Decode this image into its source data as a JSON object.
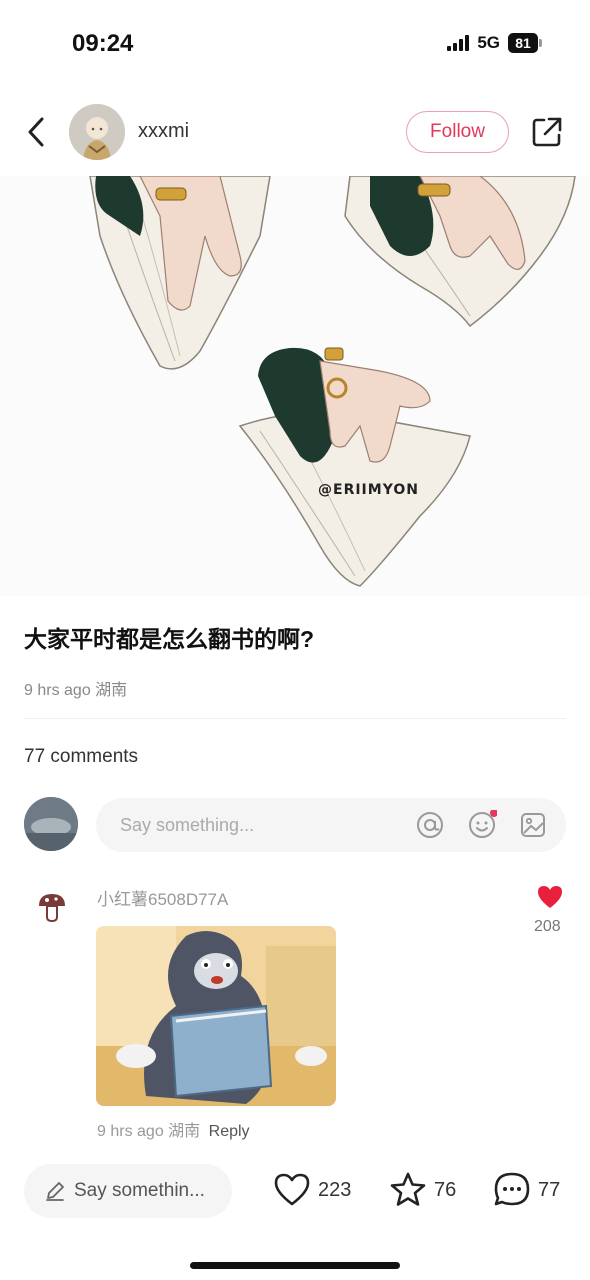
{
  "status_bar": {
    "time": "09:24",
    "network": "5G",
    "battery": "81"
  },
  "header": {
    "back_icon": "chevron-left-icon",
    "username": "xxxmi",
    "follow_label": "Follow",
    "share_icon": "share-external-icon"
  },
  "post": {
    "image_watermark": "@ERIIMYON",
    "title": "大家平时都是怎么翻书的啊?",
    "meta": "9 hrs ago 湖南",
    "comments_label": "77 comments"
  },
  "comment_input": {
    "placeholder": "Say something...",
    "icons": [
      "at-icon",
      "emoji-icon",
      "image-icon"
    ]
  },
  "comments": [
    {
      "user": "小红薯6508D77A",
      "likes": "208",
      "time": "9 hrs ago",
      "location": "湖南",
      "reply_label": "Reply"
    }
  ],
  "bottom_bar": {
    "input_placeholder": "Say somethin...",
    "like_count": "223",
    "collect_count": "76",
    "comment_count": "77"
  },
  "colors": {
    "accent": "#e2395a",
    "like": "#e8203c"
  }
}
